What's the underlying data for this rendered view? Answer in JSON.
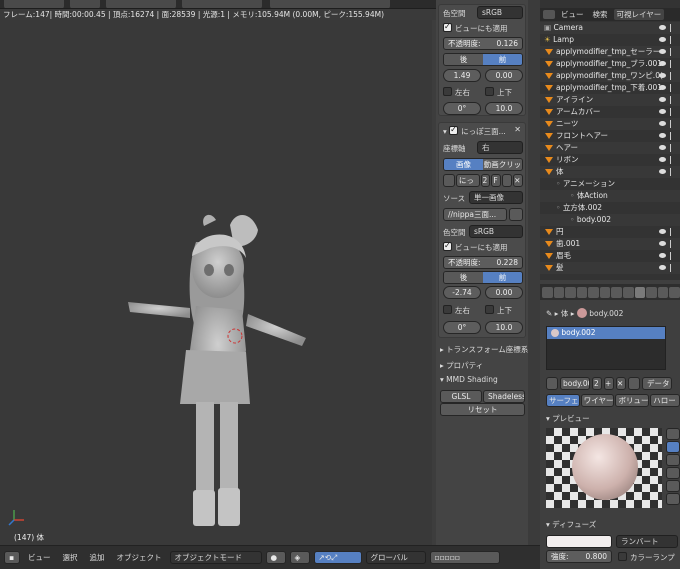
{
  "infobar": {
    "text": "フレーム:147| 時間:00:00.45 | 頂点:16274 | 面:28539 | 光源:1 | メモリ:105.94M (0.00M, ピーク:155.94M)"
  },
  "viewport": {
    "frame_label": "(147) 体"
  },
  "footer": {
    "view": "ビュー",
    "select": "選択",
    "add": "追加",
    "object": "オブジェクト",
    "mode": "オブジェクトモード",
    "pivot": "グローバル"
  },
  "npanel": {
    "top": {
      "colorspace_label": "色空間",
      "colorspace": "sRGB",
      "view_as_render": "ビューにも適用",
      "opacity": "不透明度:",
      "opacity_val": "0.126",
      "back": "後",
      "front": "前",
      "x": "1.49",
      "y": "0.00",
      "flip_x": "左右",
      "flip_y": "上下",
      "rot": "0°",
      "size": "10.0"
    },
    "bg2": {
      "title": "にっぽ三面...",
      "axis_label": "座標軸",
      "axis": "右",
      "image": "画像",
      "movie": "動画クリップ",
      "datablock": "にっ",
      "users": "2",
      "fake": "F",
      "source_label": "ソース",
      "source": "単一画像",
      "path": "//nippa三面...",
      "colorspace_label": "色空間",
      "colorspace": "sRGB",
      "view_as_render": "ビューにも適用",
      "opacity": "不透明度:",
      "opacity_val": "0.228",
      "back": "後",
      "front": "前",
      "x": "-2.74",
      "y": "0.00",
      "flip_x": "左右",
      "flip_y": "上下",
      "rot": "0°",
      "size": "10.0"
    },
    "sections": [
      "トランスフォーム座標系",
      "プロパティ",
      "MMD Shading"
    ],
    "glsl": "GLSL",
    "shadeless": "Shadeless",
    "reset": "リセット"
  },
  "outliner": {
    "tabs": [
      "ビュー",
      "検索",
      "可視レイヤー"
    ],
    "rows": [
      {
        "name": "Camera",
        "kind": "camera"
      },
      {
        "name": "Lamp",
        "kind": "lamp"
      },
      {
        "name": "applymodifier_tmp_セーラー",
        "kind": "mesh"
      },
      {
        "name": "applymodifier_tmp_ブラ.001",
        "kind": "mesh"
      },
      {
        "name": "applymodifier_tmp_ワンピ.0(",
        "kind": "mesh"
      },
      {
        "name": "applymodifier_tmp_下着.001",
        "kind": "mesh"
      },
      {
        "name": "アイライン",
        "kind": "mesh"
      },
      {
        "name": "アームカバー",
        "kind": "mesh"
      },
      {
        "name": "ニーツ",
        "kind": "mesh"
      },
      {
        "name": "フロントヘアー",
        "kind": "mesh"
      },
      {
        "name": "ヘアー",
        "kind": "mesh"
      },
      {
        "name": "リボン",
        "kind": "mesh"
      },
      {
        "name": "体",
        "kind": "mesh"
      },
      {
        "name": "アニメーション",
        "kind": "sub"
      },
      {
        "name": "体Action",
        "kind": "sub2"
      },
      {
        "name": "立方体.002",
        "kind": "sub"
      },
      {
        "name": "body.002",
        "kind": "sub2"
      },
      {
        "name": "円",
        "kind": "mesh"
      },
      {
        "name": "歯.001",
        "kind": "mesh"
      },
      {
        "name": "眉毛",
        "kind": "mesh"
      },
      {
        "name": "髪",
        "kind": "mesh"
      }
    ]
  },
  "props": {
    "breadcrumb_obj": "体",
    "breadcrumb_mat": "body.002",
    "slot": "body.002",
    "mat_name": "body.00",
    "users": "2",
    "data": "データ",
    "subtabs": [
      "サーフェス",
      "ワイヤー",
      "ボリューム",
      "ハロー"
    ],
    "preview": "プレビュー",
    "diffuse": "ディフューズ",
    "shader": "ランバート",
    "intensity_label": "強度:",
    "intensity": "0.800",
    "ramp": "カラーランプ"
  }
}
